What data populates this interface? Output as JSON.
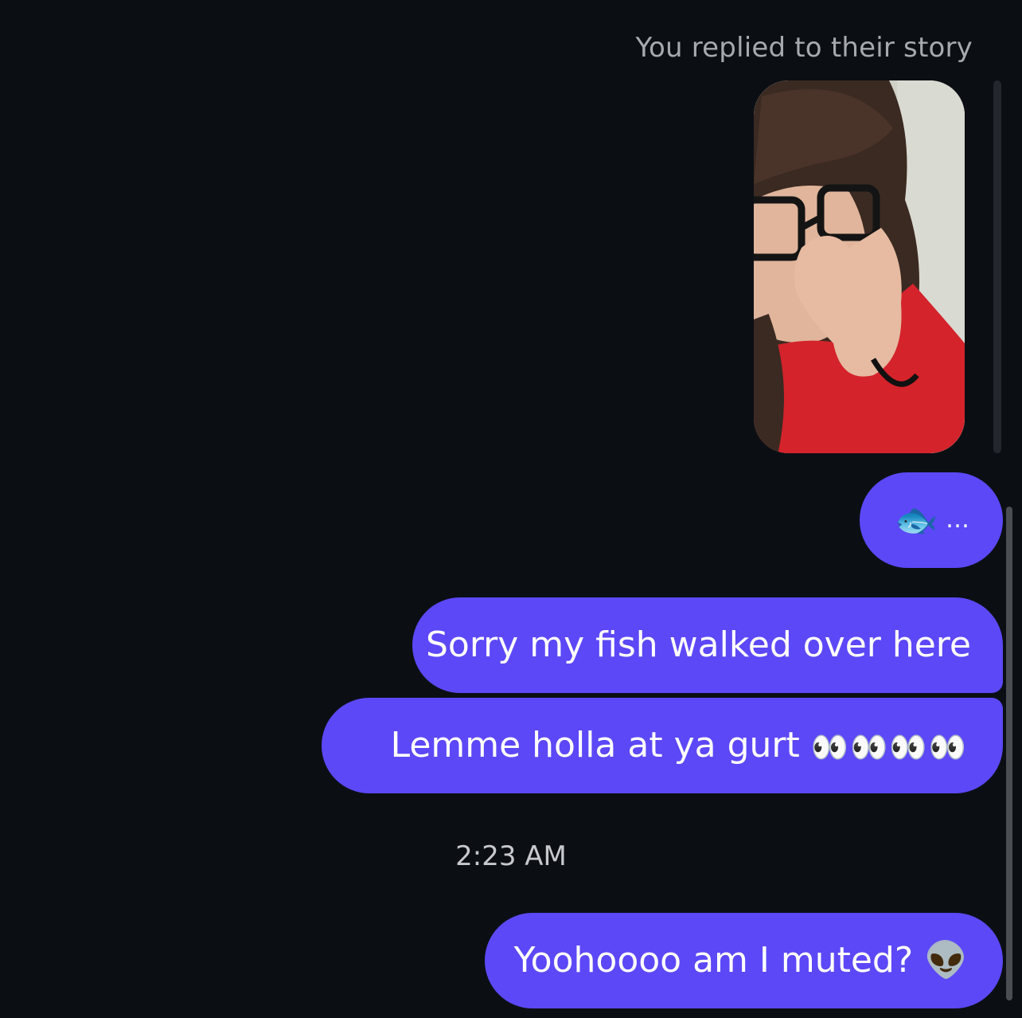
{
  "story_reply": {
    "caption": "You replied to their story"
  },
  "messages": [
    {
      "id": "fish",
      "text": "…",
      "emoji": "🐟"
    },
    {
      "id": "sorry",
      "text": "Sorry my fish walked over here"
    },
    {
      "id": "lemme",
      "text": "Lemme holla at ya gurt",
      "emoji": "👀👀👀👀"
    },
    {
      "id": "yoo",
      "text": "Yoohoooo am I muted?",
      "emoji": "👽"
    }
  ],
  "timestamp": "2:23 AM",
  "colors": {
    "background": "#0b0f14",
    "bubble": "#5c48f7",
    "caption": "#a6a9ae",
    "timestamp": "#c7c9cd"
  }
}
